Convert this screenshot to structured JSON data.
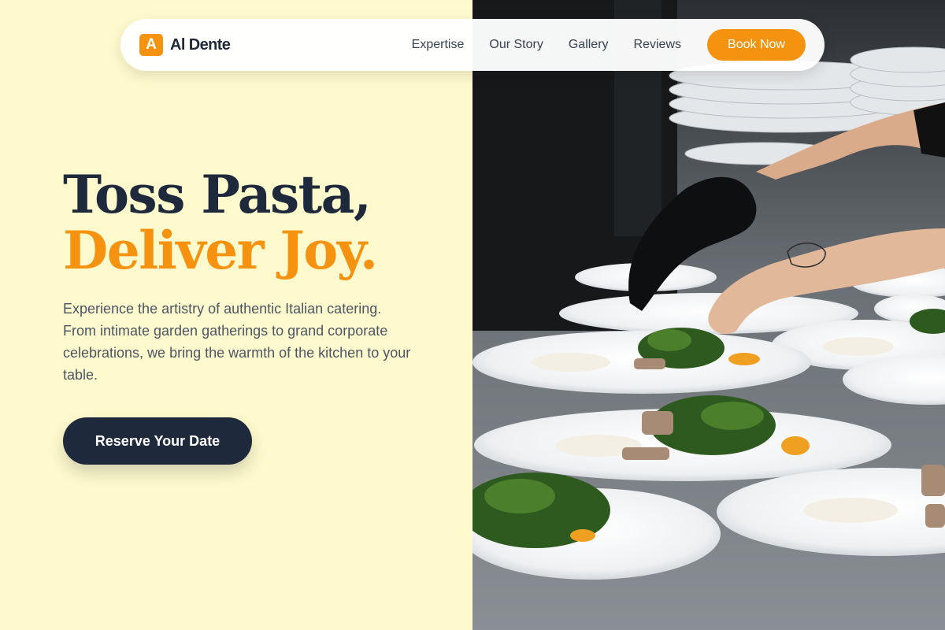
{
  "brand": {
    "mark": "A",
    "name": "Al Dente"
  },
  "nav": {
    "links": [
      "Expertise",
      "Our Story",
      "Gallery",
      "Reviews"
    ],
    "book_label": "Book Now"
  },
  "hero": {
    "title_line1": "Toss Pasta,",
    "title_line2": "Deliver Joy.",
    "description": "Experience the artistry of authentic Italian catering. From intimate garden gatherings to grand corporate celebrations, we bring the warmth of the kitchen to your table.",
    "cta_label": "Reserve Your Date"
  },
  "colors": {
    "accent": "#f59310",
    "dark": "#1e293b",
    "background": "#fffacd"
  }
}
